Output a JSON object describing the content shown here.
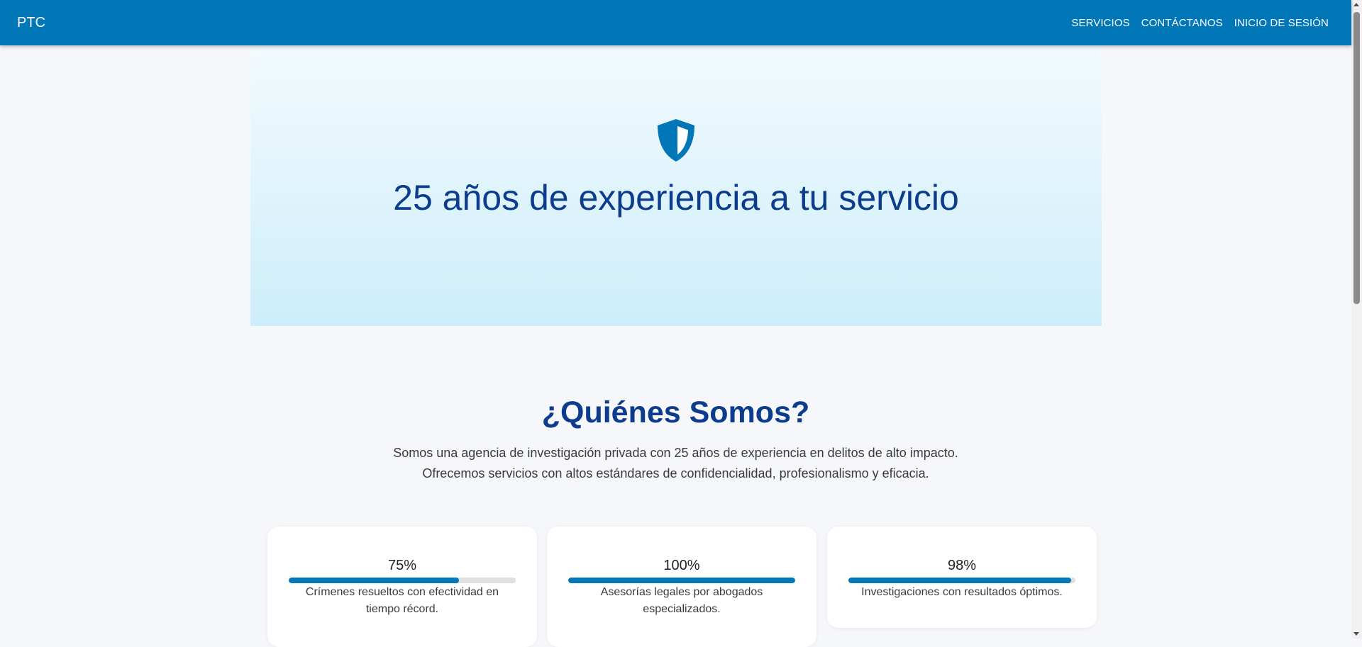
{
  "navbar": {
    "brand": "PTC",
    "links": [
      "SERVICIOS",
      "CONTÁCTANOS",
      "INICIO DE SESIÓN"
    ]
  },
  "hero": {
    "icon": "shield-icon",
    "title": "25 años de experiencia a tu servicio"
  },
  "about": {
    "title": "¿Quiénes Somos?",
    "lines": [
      "Somos una agencia de investigación privada con 25 años de experiencia en delitos de alto impacto.",
      "Ofrecemos servicios con altos estándares de confidencialidad, profesionalismo y eficacia."
    ]
  },
  "stats": [
    {
      "value": "75%",
      "progress": 0.75,
      "caption": "Crímenes resueltos con efectividad en tiempo récord."
    },
    {
      "value": "100%",
      "progress": 1.0,
      "caption": "Asesorías legales por abogados especializados."
    },
    {
      "value": "98%",
      "progress": 0.98,
      "caption": "Investigaciones con resultados óptimos."
    }
  ],
  "colors": {
    "primary": "#0277b8",
    "heading": "#0d3c8c",
    "hero_top": "#f3fafd",
    "hero_bottom": "#cdeefb",
    "page_bg": "#f6f7fa"
  }
}
